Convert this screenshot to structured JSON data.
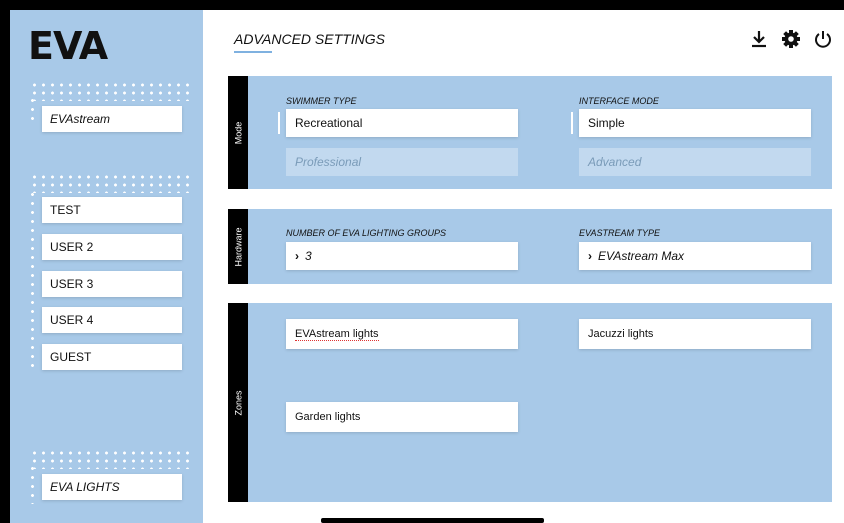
{
  "app": {
    "logo": "EVA"
  },
  "sidebar": {
    "top_item": "EVAstream",
    "users": [
      "TEST",
      "USER 2",
      "USER 3",
      "USER 4",
      "GUEST"
    ],
    "bottom_item": "EVA LIGHTS"
  },
  "header": {
    "title": "ADVANCED SETTINGS",
    "icons": [
      "download-icon",
      "gear-icon",
      "power-icon"
    ]
  },
  "mode": {
    "label": "Mode",
    "swimmer_type_label": "SWIMMER TYPE",
    "swimmer_selected": "Recreational",
    "swimmer_option": "Professional",
    "interface_mode_label": "INTERFACE MODE",
    "interface_selected": "Simple",
    "interface_option": "Advanced"
  },
  "hardware": {
    "label": "Hardware",
    "groups_label": "NUMBER OF EVA LIGHTING GROUPS",
    "groups_value": "3",
    "evastream_type_label": "EVASTREAM TYPE",
    "evastream_type_value": "EVAstream Max"
  },
  "zones": {
    "label": "Zones",
    "items": [
      "EVAstream lights",
      "Jacuzzi lights",
      "Garden lights"
    ]
  },
  "colors": {
    "accent_blue": "#a8c9e8",
    "underline": "#7fb1e0"
  }
}
